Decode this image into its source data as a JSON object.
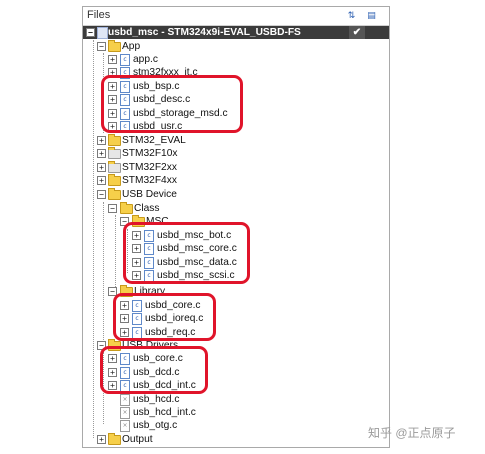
{
  "panel": {
    "title": "Files",
    "header_icons": [
      "sort-icon",
      "options-icon"
    ]
  },
  "tree": {
    "root": {
      "label": "usbd_msc - STM324x9i-EVAL_USBD-FS",
      "check": "✔"
    },
    "app": {
      "folder": "App",
      "files": [
        "app.c",
        "stm32fxxx_it.c",
        "usb_bsp.c",
        "usbd_desc.c",
        "usbd_storage_msd.c",
        "usbd_usr.c"
      ]
    },
    "folders_top": [
      "STM32_EVAL",
      "STM32F10x",
      "STM32F2xx",
      "STM32F4xx"
    ],
    "usb_device": {
      "folder": "USB Device",
      "class_folder": "Class",
      "msc_folder": "MSC",
      "msc_files": [
        "usbd_msc_bot.c",
        "usbd_msc_core.c",
        "usbd_msc_data.c",
        "usbd_msc_scsi.c"
      ],
      "library_folder": "Library",
      "library_files": [
        "usbd_core.c",
        "usbd_ioreq.c",
        "usbd_req.c"
      ]
    },
    "usb_drivers": {
      "folder": "USB Drivers",
      "files": [
        "usb_core.c",
        "usb_dcd.c",
        "usb_dcd_int.c"
      ],
      "excluded_files": [
        "usb_hcd.c",
        "usb_hcd_int.c",
        "usb_otg.c"
      ]
    },
    "output_folder": "Output"
  },
  "watermark": "知乎 @正点原子",
  "colors": {
    "highlight": "#e0142a",
    "folder": "#f6cf4a",
    "root_row": "#3b3b3b"
  }
}
